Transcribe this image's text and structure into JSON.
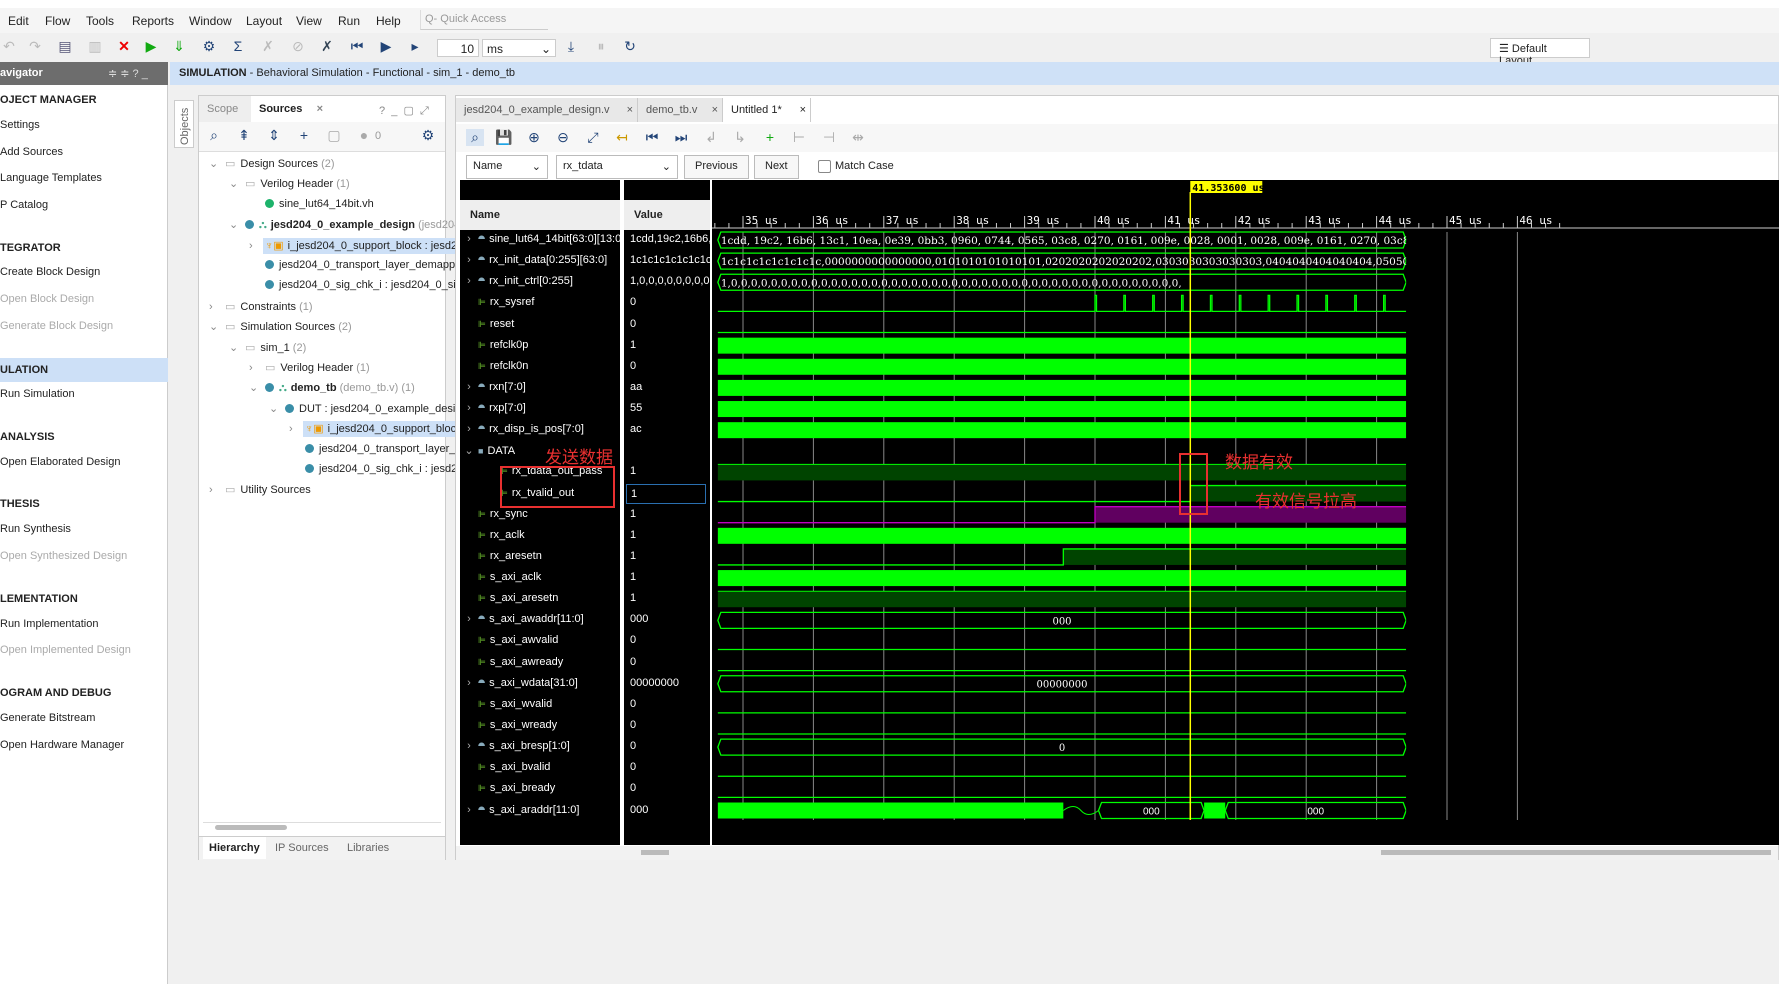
{
  "menu": [
    "Edit",
    "Flow",
    "Tools",
    "Reports",
    "Window",
    "Layout",
    "View",
    "Run",
    "Help"
  ],
  "quick_access_placeholder": "Q- Quick Access",
  "toolbar": {
    "run_time": "10",
    "run_unit": "ms",
    "layout": "Default Layout"
  },
  "navigator": {
    "title": "avigator",
    "items": [
      {
        "label": "OJECT MANAGER",
        "type": "header"
      },
      {
        "label": "Settings"
      },
      {
        "label": "Add Sources"
      },
      {
        "label": "Language Templates"
      },
      {
        "label": "P Catalog"
      },
      {
        "label": "TEGRATOR",
        "type": "header"
      },
      {
        "label": "Create Block Design"
      },
      {
        "label": "Open Block Design",
        "disabled": true
      },
      {
        "label": "Generate Block Design",
        "disabled": true
      },
      {
        "label": "ULATION",
        "type": "header",
        "selected": true
      },
      {
        "label": "Run Simulation"
      },
      {
        "label": " ANALYSIS",
        "type": "header"
      },
      {
        "label": "Open Elaborated Design"
      },
      {
        "label": "THESIS",
        "type": "header"
      },
      {
        "label": "Run Synthesis"
      },
      {
        "label": "Open Synthesized Design",
        "disabled": true
      },
      {
        "label": "LEMENTATION",
        "type": "header"
      },
      {
        "label": "Run Implementation"
      },
      {
        "label": "Open Implemented Design",
        "disabled": true
      },
      {
        "label": "OGRAM AND DEBUG",
        "type": "header"
      },
      {
        "label": "Generate Bitstream"
      },
      {
        "label": "Open Hardware Manager"
      }
    ]
  },
  "sim_header": {
    "bold": "SIMULATION",
    "rest": " - Behavioral Simulation - Functional - sim_1 - demo_tb"
  },
  "objects_tab": "Objects",
  "sources": {
    "tabs": [
      "Scope",
      "Sources"
    ],
    "active": "Sources",
    "count": "0",
    "tree": [
      {
        "t": "Design Sources",
        "c": " (2)",
        "lvl": 0,
        "exp": "v",
        "icon": "folder"
      },
      {
        "t": "Verilog Header",
        "c": " (1)",
        "lvl": 1,
        "exp": "v",
        "icon": "folder"
      },
      {
        "t": "sine_lut64_14bit.vh",
        "lvl": 2,
        "icon": "green-dot"
      },
      {
        "t": "jesd204_0_example_design",
        "c": " (jesd204",
        "lvl": 1,
        "exp": "v",
        "icon": "top",
        "bold": true
      },
      {
        "t": "i_jesd204_0_support_block : jesd2",
        "lvl": 2,
        "exp": ">",
        "icon": "ip",
        "sel": true
      },
      {
        "t": "jesd204_0_transport_layer_demappe",
        "lvl": 2,
        "icon": "dot"
      },
      {
        "t": "jesd204_0_sig_chk_i : jesd204_0_sig",
        "lvl": 2,
        "icon": "dot"
      },
      {
        "t": "Constraints",
        "c": " (1)",
        "lvl": 0,
        "exp": ">",
        "icon": "folder"
      },
      {
        "t": "Simulation Sources",
        "c": " (2)",
        "lvl": 0,
        "exp": "v",
        "icon": "folder"
      },
      {
        "t": "sim_1",
        "c": " (2)",
        "lvl": 1,
        "exp": "v",
        "icon": "folder"
      },
      {
        "t": "Verilog Header",
        "c": " (1)",
        "lvl": 2,
        "exp": ">",
        "icon": "folder"
      },
      {
        "t": "demo_tb",
        "c": " (demo_tb.v) (1)",
        "lvl": 2,
        "exp": "v",
        "icon": "top",
        "bold": true
      },
      {
        "t": "DUT : jesd204_0_example_desig",
        "lvl": 3,
        "exp": "v",
        "icon": "dot"
      },
      {
        "t": "i_jesd204_0_support_bloc",
        "lvl": 4,
        "exp": ">",
        "icon": "ip",
        "sel": true
      },
      {
        "t": "jesd204_0_transport_layer_",
        "lvl": 4,
        "icon": "dot"
      },
      {
        "t": "jesd204_0_sig_chk_i : jesd2",
        "lvl": 4,
        "icon": "dot"
      },
      {
        "t": "Utility Sources",
        "lvl": 0,
        "exp": ">",
        "icon": "folder"
      }
    ],
    "bottom_tabs": [
      "Hierarchy",
      "IP Sources",
      "Libraries"
    ]
  },
  "wave_tabs": [
    {
      "label": "jesd204_0_example_design.v"
    },
    {
      "label": "demo_tb.v"
    },
    {
      "label": "Untitled 1*",
      "active": true
    }
  ],
  "search": {
    "field": "Name",
    "value": "rx_tdata",
    "previous": "Previous",
    "next": "Next",
    "match_case": "Match Case"
  },
  "columns": {
    "name": "Name",
    "value": "Value"
  },
  "cursor": {
    "label": "41.353600 us",
    "time": 41.3536
  },
  "timeline": {
    "ticks": [
      35,
      36,
      37,
      38,
      39,
      40,
      41,
      42,
      43,
      44,
      45,
      46
    ],
    "unit": "us",
    "sim_end": 44.42
  },
  "signals": [
    {
      "name": "sine_lut64_14bit[63:0][13:0]",
      "value": "1cdd,19c2,16b6,1",
      "icon": "bus",
      "exp": ">",
      "wave": "bus",
      "text": "1cdd, 19c2, 16b6, 13c1, 10ea, 0e39, 0bb3, 0960, 0744, 0565, 03c8, 0270, 0161, 009e, 0028, 0001, 0028, 009e, 0161, 0270, 03c8, 0565, 0744, 0960,"
    },
    {
      "name": "rx_init_data[0:255][63:0]",
      "value": "1c1c1c1c1c1c1c1c",
      "icon": "bus",
      "exp": ">",
      "wave": "bus",
      "text": "1c1c1c1c1c1c1c1c,0000000000000000,0101010101010101,0202020202020202,0303030303030303,0404040404040404,0505050505050505,0"
    },
    {
      "name": "rx_init_ctrl[0:255]",
      "value": "1,0,0,0,0,0,0,0,0",
      "icon": "bus",
      "exp": ">",
      "wave": "bus",
      "text": "1,0,0,0,0,0,0,0,0,0,0,0,0,0,0,0,0,0,0,0,0,0,0,0,0,0,0,0,0,0,0,0,0,0,0,0,0,0,0,0,0,0,0,0,0,0,"
    },
    {
      "name": "rx_sysref",
      "value": "0",
      "icon": "bit",
      "wave": "pulses",
      "pulses": [
        40.0,
        40.41,
        40.82,
        41.23,
        41.64,
        42.05,
        42.46,
        42.87,
        43.28,
        43.69,
        44.1
      ]
    },
    {
      "name": "reset",
      "value": "0",
      "icon": "bit",
      "wave": "low"
    },
    {
      "name": "refclk0p",
      "value": "1",
      "icon": "bit",
      "wave": "clock"
    },
    {
      "name": "refclk0n",
      "value": "0",
      "icon": "bit",
      "wave": "clock"
    },
    {
      "name": "rxn[7:0]",
      "value": "aa",
      "icon": "bus",
      "exp": ">",
      "wave": "clock"
    },
    {
      "name": "rxp[7:0]",
      "value": "55",
      "icon": "bus",
      "exp": ">",
      "wave": "clock"
    },
    {
      "name": "rx_disp_is_pos[7:0]",
      "value": "ac",
      "icon": "bus",
      "exp": ">",
      "wave": "clock"
    },
    {
      "name": "DATA",
      "value": "",
      "icon": "group",
      "exp": "v",
      "wave": "none"
    },
    {
      "name": "rx_tdata_out_pass",
      "value": "1",
      "icon": "bit",
      "indent": true,
      "wave": "high"
    },
    {
      "name": "rx_tvalid_out",
      "value": "1",
      "icon": "bit",
      "indent": true,
      "wave": "step",
      "rise": 41.3536,
      "selected": true
    },
    {
      "name": "rx_sync",
      "value": "1",
      "icon": "bit",
      "wave": "step",
      "rise": 40.0,
      "color": "#c000c0"
    },
    {
      "name": "rx_aclk",
      "value": "1",
      "icon": "bit",
      "wave": "clock"
    },
    {
      "name": "rx_aresetn",
      "value": "1",
      "icon": "bit",
      "wave": "step",
      "rise": 39.55
    },
    {
      "name": "s_axi_aclk",
      "value": "1",
      "icon": "bit",
      "wave": "clock"
    },
    {
      "name": "s_axi_aresetn",
      "value": "1",
      "icon": "bit",
      "wave": "high"
    },
    {
      "name": "s_axi_awaddr[11:0]",
      "value": "000",
      "icon": "bus",
      "exp": ">",
      "wave": "bus",
      "text": "000",
      "center": true
    },
    {
      "name": "s_axi_awvalid",
      "value": "0",
      "icon": "bit",
      "wave": "low"
    },
    {
      "name": "s_axi_awready",
      "value": "0",
      "icon": "bit",
      "wave": "low"
    },
    {
      "name": "s_axi_wdata[31:0]",
      "value": "00000000",
      "icon": "bus",
      "exp": ">",
      "wave": "bus",
      "text": "00000000",
      "center": true
    },
    {
      "name": "s_axi_wvalid",
      "value": "0",
      "icon": "bit",
      "wave": "low"
    },
    {
      "name": "s_axi_wready",
      "value": "0",
      "icon": "bit",
      "wave": "low"
    },
    {
      "name": "s_axi_bresp[1:0]",
      "value": "0",
      "icon": "bus",
      "exp": ">",
      "wave": "bus",
      "text": "0",
      "center": true
    },
    {
      "name": "s_axi_bvalid",
      "value": "0",
      "icon": "bit",
      "wave": "low"
    },
    {
      "name": "s_axi_bready",
      "value": "0",
      "icon": "bit",
      "wave": "low"
    },
    {
      "name": "s_axi_araddr[11:0]",
      "value": "000",
      "icon": "bus",
      "exp": ">",
      "wave": "mixed",
      "busy_until": 39.55,
      "segments": [
        {
          "from": 40.05,
          "to": 41.55,
          "text": "000"
        },
        {
          "from": 41.55,
          "to": 41.85,
          "busy": true
        },
        {
          "from": 41.85,
          "to": 44.42,
          "text": "000"
        }
      ]
    }
  ],
  "annotations": {
    "send": "发送数据",
    "valid": "数据有效",
    "raised": "有效信号拉高",
    "color": "#e83030"
  },
  "colors": {
    "wave": "#00ff00",
    "wave_dim": "#004400",
    "cursor": "#ffff00",
    "grid": "#888888",
    "accent": "#cfe1f7"
  }
}
